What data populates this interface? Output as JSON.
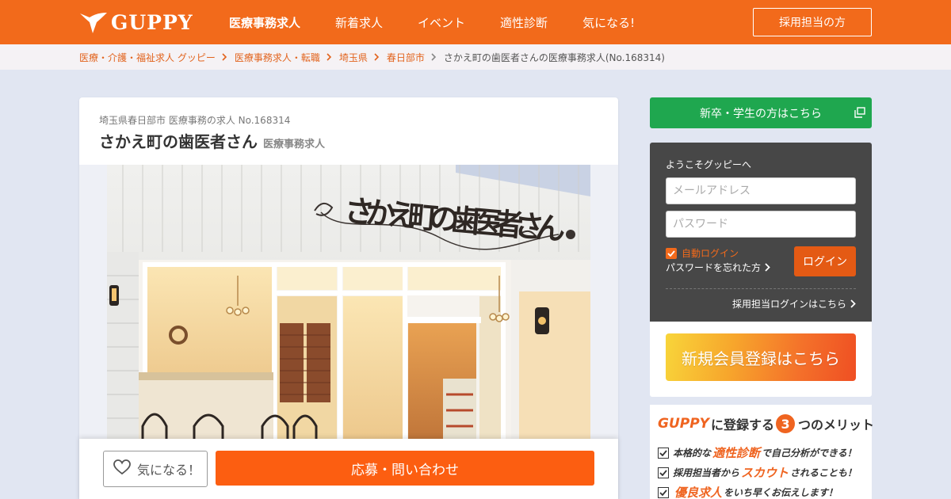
{
  "header": {
    "logo_text": "GUPPY",
    "nav": [
      {
        "label": "医療事務求人",
        "active": true
      },
      {
        "label": "新着求人",
        "active": false
      },
      {
        "label": "イベント",
        "active": false
      },
      {
        "label": "適性診断",
        "active": false
      },
      {
        "label": "気になる!",
        "active": false
      }
    ],
    "recruiter_button": "採用担当の方"
  },
  "breadcrumb": {
    "links": [
      "医療・介護・福祉求人 グッピー",
      "医療事務求人・転職",
      "埼玉県",
      "春日部市"
    ],
    "current": "さかえ町の歯医者さんの医療事務求人(No.168314)"
  },
  "job": {
    "subtitle": "埼玉県春日部市 医療事務の求人 No.168314",
    "title": "さかえ町の歯医者さん",
    "category_tag": "医療事務求人",
    "photo_sign_text": "さかえ町の歯医者さん"
  },
  "actions": {
    "favorite_label": "気になる！",
    "apply_label": "応募・問い合わせ"
  },
  "sidebar": {
    "graduate_button": "新卒・学生の方はこちら",
    "welcome": "ようこそグッピーへ",
    "email_placeholder": "メールアドレス",
    "password_placeholder": "パスワード",
    "auto_login": "自動ログイン",
    "auto_login_checked": true,
    "forgot_password": "パスワードを忘れた方",
    "login_button": "ログイン",
    "recruiter_login": "採用担当ログインはこちら",
    "register_button": "新規会員登録はこちら"
  },
  "merits": {
    "brand": "GUPPY",
    "title_part1": "に登録する",
    "number": "3",
    "title_part2": "つのメリット",
    "items": [
      {
        "pre": "本格的な",
        "highlight": "適性診断",
        "post": "で自己分析ができる！"
      },
      {
        "pre": "採用担当者から",
        "highlight": "スカウト",
        "post": "されることも！"
      },
      {
        "pre": "",
        "highlight": "優良求人",
        "post": "をいち早くお伝えします！"
      }
    ]
  },
  "colors": {
    "brand_orange": "#f26a1b",
    "apply_orange": "#fc5e11",
    "graduate_green": "#1fa74f",
    "login_panel": "#474747"
  }
}
